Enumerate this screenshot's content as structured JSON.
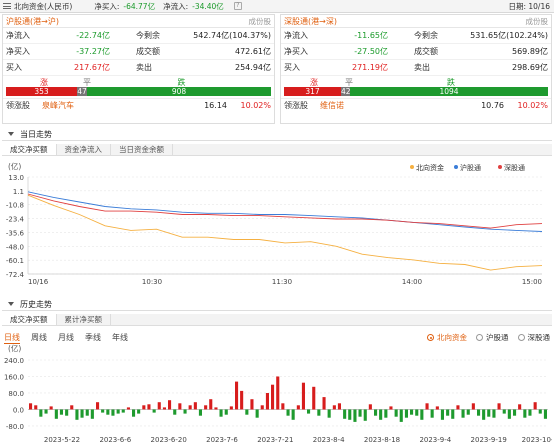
{
  "topbar": {
    "title": "北向资金(人民币)",
    "net_buy_label": "净买入:",
    "net_buy_value": "-64.77亿",
    "net_inflow_label": "净流入:",
    "net_inflow_value": "-34.40亿",
    "help": "?",
    "date": "日期: 10/16"
  },
  "sh": {
    "title": "沪股通(港→沪)",
    "link": "成份股",
    "rows": [
      {
        "k1": "净流入",
        "v1": "-22.74亿",
        "k2": "今剩余",
        "v2": "542.74亿(104.37%)"
      },
      {
        "k1": "净买入",
        "v1": "-37.27亿",
        "k2": "成交额",
        "v2": "472.61亿"
      },
      {
        "k1": "买入",
        "v1": "217.67亿",
        "k2": "卖出",
        "v2": "254.94亿"
      }
    ],
    "ratio": {
      "up_label": "涨",
      "flat_label": "平",
      "down_label": "跌",
      "up": "353",
      "flat": "47",
      "down": "908"
    },
    "leader": {
      "label": "领涨股",
      "name": "泉峰汽车",
      "price": "16.14",
      "change": "10.02%"
    }
  },
  "sz": {
    "title": "深股通(港→深)",
    "link": "成份股",
    "rows": [
      {
        "k1": "净流入",
        "v1": "-11.65亿",
        "k2": "今剩余",
        "v2": "531.65亿(102.24%)"
      },
      {
        "k1": "净买入",
        "v1": "-27.50亿",
        "k2": "成交额",
        "v2": "569.89亿"
      },
      {
        "k1": "买入",
        "v1": "271.19亿",
        "k2": "卖出",
        "v2": "298.69亿"
      }
    ],
    "ratio": {
      "up_label": "涨",
      "flat_label": "平",
      "down_label": "跌",
      "up": "317",
      "flat": "42",
      "down": "1094"
    },
    "leader": {
      "label": "领涨股",
      "name": "维信诺",
      "price": "10.76",
      "change": "10.02%"
    }
  },
  "today": {
    "section": "当日走势",
    "tabs": [
      "成交净买额",
      "资金净流入",
      "当日资金余额"
    ]
  },
  "history": {
    "section": "历史走势",
    "tabs": [
      "成交净买额",
      "累计净买额"
    ],
    "periods": [
      "日线",
      "周线",
      "月线",
      "季线",
      "年线"
    ],
    "radios": [
      "北向资金",
      "沪股通",
      "深股通"
    ]
  },
  "colors": {
    "north": "#f5b041",
    "sh": "#3b7dd8",
    "sz": "#e04040",
    "up": "#d71d1d",
    "down": "#1e9a2e"
  },
  "chart_data": [
    {
      "type": "line",
      "unit": "(亿)",
      "ylim": [
        -72.4,
        13.0
      ],
      "yticks": [
        "13.0",
        "1.1",
        "-10.8",
        "-23.4",
        "-35.6",
        "-48.0",
        "-60.1",
        "-72.4"
      ],
      "xticks": [
        "10/16",
        "10:30",
        "11:30",
        "14:00",
        "15:00"
      ],
      "series": [
        {
          "name": "北向资金",
          "color": "#f5b041",
          "x": [
            0,
            0.05,
            0.1,
            0.15,
            0.2,
            0.25,
            0.3,
            0.35,
            0.4,
            0.45,
            0.5,
            0.55,
            0.6,
            0.65,
            0.7,
            0.75,
            0.8,
            0.85,
            0.9,
            0.95,
            1.0
          ],
          "values": [
            -3,
            -12,
            -20,
            -30,
            -34,
            -33,
            -40,
            -40,
            -42,
            -42,
            -45,
            -44,
            -48,
            -55,
            -58,
            -60,
            -63,
            -64,
            -69,
            -66,
            -65
          ]
        },
        {
          "name": "沪股通",
          "color": "#3b7dd8",
          "x": [
            0,
            0.05,
            0.1,
            0.15,
            0.2,
            0.25,
            0.3,
            0.35,
            0.4,
            0.45,
            0.5,
            0.55,
            0.6,
            0.65,
            0.7,
            0.75,
            0.8,
            0.85,
            0.9,
            0.95,
            1.0
          ],
          "values": [
            0,
            -5,
            -9,
            -13,
            -15,
            -16,
            -18,
            -19,
            -19,
            -20,
            -20,
            -21,
            -22,
            -23,
            -25,
            -27,
            -29,
            -31,
            -33,
            -34,
            -35
          ]
        },
        {
          "name": "深股通",
          "color": "#e04040",
          "x": [
            0,
            0.05,
            0.1,
            0.15,
            0.2,
            0.25,
            0.3,
            0.35,
            0.4,
            0.45,
            0.5,
            0.55,
            0.6,
            0.65,
            0.7,
            0.75,
            0.8,
            0.85,
            0.9,
            0.95,
            1.0
          ],
          "values": [
            -2,
            -8,
            -13,
            -17,
            -17,
            -18,
            -20,
            -20,
            -21,
            -21,
            -22,
            -23,
            -24,
            -24,
            -25,
            -27,
            -28,
            -30,
            -32,
            -29,
            -28
          ]
        }
      ]
    },
    {
      "type": "bar",
      "unit": "(亿)",
      "ylim": [
        -90,
        240
      ],
      "yticks": [
        "240.0",
        "160.0",
        "80.0",
        "0.0",
        "-80.0"
      ],
      "xticks": [
        "2023-5-22",
        "2023-6-6",
        "2023-6-20",
        "2023-7-6",
        "2023-7-21",
        "2023-8-4",
        "2023-8-18",
        "2023-9-4",
        "2023-9-19",
        "2023-10-11"
      ],
      "values": [
        30,
        20,
        -35,
        -20,
        15,
        -45,
        -25,
        -30,
        20,
        -50,
        -40,
        -30,
        -45,
        35,
        -15,
        -25,
        -30,
        -20,
        -15,
        10,
        -35,
        -20,
        20,
        25,
        -15,
        35,
        10,
        45,
        -25,
        30,
        -20,
        20,
        35,
        -30,
        20,
        50,
        10,
        -35,
        -25,
        15,
        135,
        90,
        -25,
        50,
        -40,
        20,
        80,
        120,
        160,
        30,
        -30,
        -50,
        20,
        130,
        -20,
        110,
        -30,
        60,
        -40,
        20,
        30,
        -45,
        -50,
        -60,
        -35,
        -55,
        25,
        -30,
        -50,
        -40,
        15,
        -35,
        -60,
        -40,
        -25,
        -30,
        -50,
        30,
        -40,
        15,
        -50,
        -30,
        -45,
        20,
        -40,
        -25,
        30,
        -30,
        -50,
        -35,
        -40,
        30,
        -20,
        -45,
        -30,
        25,
        -40,
        -30,
        35,
        -20,
        -45
      ]
    }
  ]
}
